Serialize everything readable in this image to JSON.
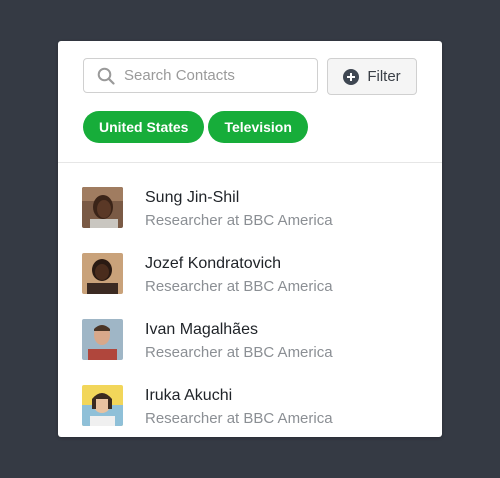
{
  "search": {
    "placeholder": "Search Contacts"
  },
  "filter": {
    "label": "Filter"
  },
  "tags": [
    {
      "label": "United States"
    },
    {
      "label": "Television"
    }
  ],
  "contacts": [
    {
      "name": "Sung Jin-Shil",
      "role": "Researcher at BBC America"
    },
    {
      "name": "Jozef Kondratovich",
      "role": "Researcher at BBC America"
    },
    {
      "name": "Ivan Magalhães",
      "role": "Researcher at BBC America"
    },
    {
      "name": "Iruka Akuchi",
      "role": "Researcher at BBC America"
    }
  ],
  "colors": {
    "background": "#353a44",
    "card": "#ffffff",
    "tag": "#17ad3a",
    "name_text": "#1f2328",
    "role_text": "#8b8f94"
  }
}
